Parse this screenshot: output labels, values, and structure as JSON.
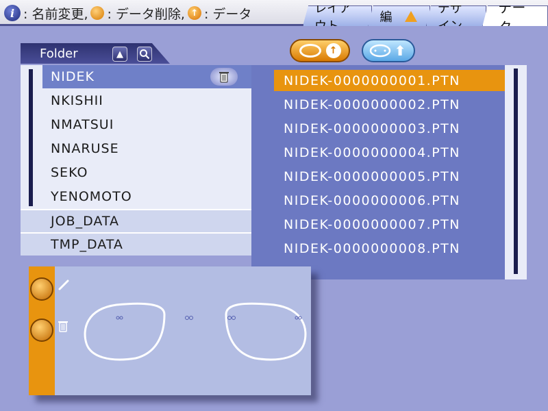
{
  "hint": {
    "part1": ": 名前変更,",
    "part2": ": データ削除,",
    "part3": ": データ"
  },
  "tabs": [
    {
      "label": "レイアウト"
    },
    {
      "label": "穴編集"
    },
    {
      "label": "デザイン"
    },
    {
      "label": "データ"
    }
  ],
  "folder_panel": {
    "title": "Folder",
    "items": [
      {
        "label": "NIDEK",
        "selected": true
      },
      {
        "label": "NKISHII"
      },
      {
        "label": "NMATSUI"
      },
      {
        "label": "NNARUSE"
      },
      {
        "label": "SEKO"
      },
      {
        "label": "YENOMOTO"
      },
      {
        "label": "JOB_DATA"
      },
      {
        "label": "TMP_DATA"
      }
    ]
  },
  "files": [
    {
      "name": "NIDEK-0000000001.PTN",
      "selected": true
    },
    {
      "name": "NIDEK-0000000002.PTN"
    },
    {
      "name": "NIDEK-0000000003.PTN"
    },
    {
      "name": "NIDEK-0000000004.PTN"
    },
    {
      "name": "NIDEK-0000000005.PTN"
    },
    {
      "name": "NIDEK-0000000006.PTN"
    },
    {
      "name": "NIDEK-0000000007.PTN"
    },
    {
      "name": "NIDEK-0000000008.PTN"
    }
  ],
  "colors": {
    "accent_orange": "#e8940f",
    "file_panel_bg": "#6c79c2",
    "selected_folder": "#6f80c8",
    "background": "#9a9fd6"
  }
}
